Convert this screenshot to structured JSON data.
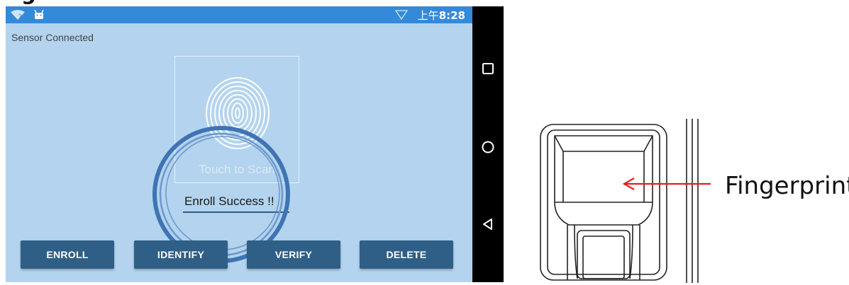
{
  "heading": "g",
  "status_bar": {
    "time_prefix": "上午",
    "time": "8:28"
  },
  "sensor_status": "Sensor Connected",
  "scan_area": {
    "placeholder": "Touch to Scan"
  },
  "result_field": {
    "value": "Enroll Success !!"
  },
  "buttons": {
    "enroll": "ENROLL",
    "identify": "IDENTIFY",
    "verify": "VERIFY",
    "delete": "DELETE"
  },
  "nav_bar": {
    "icons": [
      "recent-apps-icon",
      "home-icon",
      "back-icon"
    ]
  },
  "callout": {
    "label": "Fingerprint"
  },
  "colors": {
    "status_bar": "#3589d9",
    "screen_background": "#b3d3ee",
    "button": "#2f5f87",
    "highlight_ring": "#3f74b4",
    "arrow": "#e02020"
  }
}
